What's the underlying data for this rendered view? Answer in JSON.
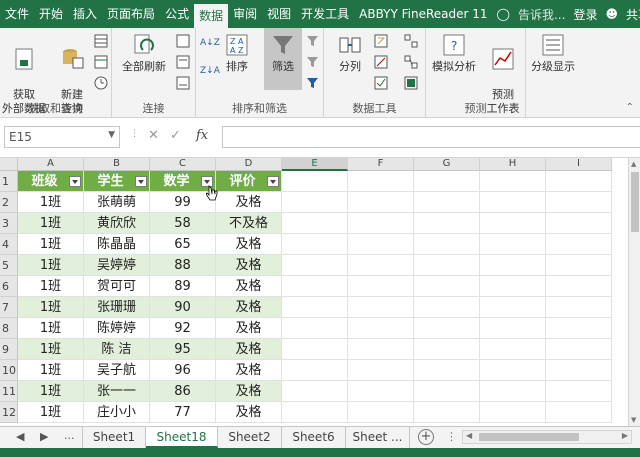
{
  "menubar": {
    "tabs": [
      "文件",
      "开始",
      "插入",
      "页面布局",
      "公式",
      "数据",
      "审阅",
      "视图",
      "开发工具",
      "ABBYY FineReader 11"
    ],
    "active_tab": "数据",
    "tell_me": "告诉我...",
    "login": "登录",
    "share": "共享"
  },
  "ribbon": {
    "get_external": "获取\n外部数据",
    "new_query": "新建\n查询",
    "group_get": "获取和转换",
    "refresh_all": "全部刷新",
    "group_connect": "连接",
    "sort": "排序",
    "filter": "筛选",
    "group_sort": "排序和筛选",
    "split": "分列",
    "group_datatools": "数据工具",
    "whatif": "模拟分析",
    "forecast": "预测\n工作表",
    "group_forecast": "预测",
    "outline": "分级显示"
  },
  "formulabar": {
    "namebox": "E15",
    "fx": "fx",
    "cancel": "✕",
    "enter": "✓",
    "value": ""
  },
  "grid": {
    "columns": [
      "A",
      "B",
      "C",
      "D",
      "E",
      "F",
      "G",
      "H",
      "I"
    ],
    "selected_column": "E",
    "rows": [
      "1",
      "2",
      "3",
      "4",
      "5",
      "6",
      "7",
      "8",
      "9",
      "10",
      "11",
      "12"
    ],
    "headers": [
      "班级",
      "学生",
      "数学",
      "评价"
    ],
    "data": [
      [
        "1班",
        "张萌萌",
        "99",
        "及格"
      ],
      [
        "1班",
        "黄欣欣",
        "58",
        "不及格"
      ],
      [
        "1班",
        "陈晶晶",
        "65",
        "及格"
      ],
      [
        "1班",
        "吴婷婷",
        "88",
        "及格"
      ],
      [
        "1班",
        "贺可可",
        "89",
        "及格"
      ],
      [
        "1班",
        "张珊珊",
        "90",
        "及格"
      ],
      [
        "1班",
        "陈婷婷",
        "92",
        "及格"
      ],
      [
        "1班",
        "陈  洁",
        "95",
        "及格"
      ],
      [
        "1班",
        "吴子航",
        "96",
        "及格"
      ],
      [
        "1班",
        "张一一",
        "86",
        "及格"
      ],
      [
        "1班",
        "庄小小",
        "77",
        "及格"
      ]
    ]
  },
  "sheets": {
    "nav_prev": "◀",
    "nav_next": "▶",
    "ellipsis": "...",
    "tabs": [
      "Sheet1",
      "Sheet18",
      "Sheet2",
      "Sheet6",
      "Sheet ..."
    ],
    "active": "Sheet18",
    "add": "+"
  },
  "colors": {
    "accent": "#217346",
    "header": "#70ad47",
    "band": "#e2efda"
  }
}
